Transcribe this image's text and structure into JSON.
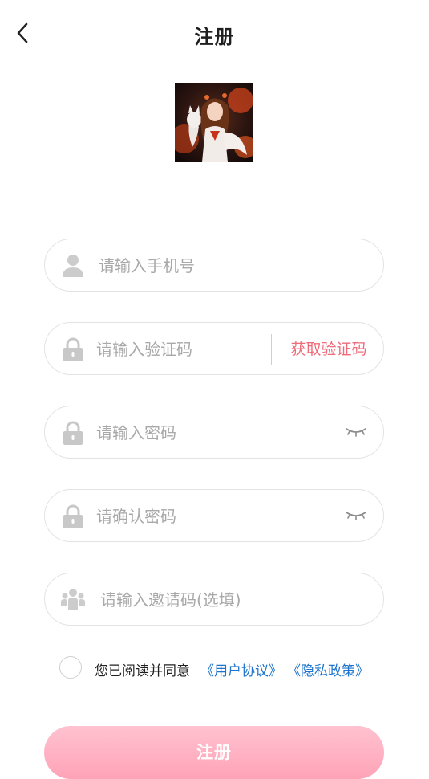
{
  "header": {
    "title": "注册"
  },
  "form": {
    "phone_placeholder": "请输入手机号",
    "code_placeholder": "请输入验证码",
    "get_code_label": "获取验证码",
    "password_placeholder": "请输入密码",
    "confirm_placeholder": "请确认密码",
    "invite_placeholder": "请输入邀请码(选填)"
  },
  "agreement": {
    "text": "您已阅读并同意",
    "user_agreement": "《用户协议》",
    "privacy_policy": "《隐私政策》"
  },
  "submit_label": "注册",
  "colors": {
    "accent": "#f06b7a",
    "link": "#1e74cc",
    "button": "#ffb0c2"
  }
}
